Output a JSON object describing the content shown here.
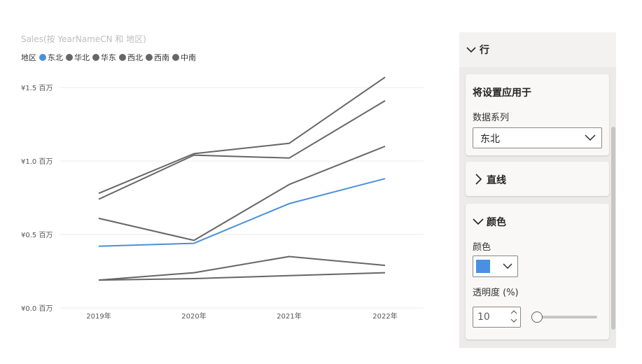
{
  "chart": {
    "title": "Sales(按 YearNameCN 和 地区)",
    "legend_label": "地区"
  },
  "chart_data": {
    "type": "line",
    "categories": [
      "2019年",
      "2020年",
      "2021年",
      "2022年"
    ],
    "y_ticks": [
      {
        "value": 0,
        "label": "¥0.0 百万"
      },
      {
        "value": 0.5,
        "label": "¥0.5 百万"
      },
      {
        "value": 1.0,
        "label": "¥1.0 百万"
      },
      {
        "value": 1.5,
        "label": "¥1.5 百万"
      }
    ],
    "ylim": [
      0,
      1.5
    ],
    "grid": true,
    "legend_position": "top-left",
    "series": [
      {
        "name": "东北",
        "color": "#4a90d9",
        "values": [
          0.42,
          0.44,
          0.71,
          0.88
        ]
      },
      {
        "name": "华北",
        "color": "#666666",
        "values": [
          0.78,
          1.05,
          1.12,
          1.57
        ]
      },
      {
        "name": "华东",
        "color": "#666666",
        "values": [
          0.74,
          1.04,
          1.02,
          1.41
        ]
      },
      {
        "name": "西北",
        "color": "#666666",
        "values": [
          0.61,
          0.46,
          0.84,
          1.1
        ]
      },
      {
        "name": "西南",
        "color": "#666666",
        "values": [
          0.19,
          0.24,
          0.35,
          0.29
        ]
      },
      {
        "name": "中南",
        "color": "#666666",
        "values": [
          0.19,
          0.2,
          0.22,
          0.24
        ]
      }
    ]
  },
  "pane": {
    "header_label": "行",
    "apply_card": {
      "title": "将设置应用于",
      "series_label": "数据系列",
      "series_value": "东北"
    },
    "line_card": {
      "title": "直线"
    },
    "color_card": {
      "title": "颜色",
      "color_label": "颜色",
      "color_value": "#4a90e2",
      "transparency_label": "透明度 (%)",
      "transparency_value": "10"
    }
  }
}
